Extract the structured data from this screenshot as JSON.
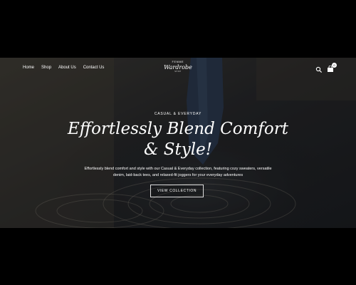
{
  "nav": {
    "links": [
      "Home",
      "Shop",
      "About Us",
      "Contact Us"
    ]
  },
  "brand": {
    "top": "FEMME",
    "name": "Wardrobe",
    "sub": "SHOP"
  },
  "cart": {
    "count": "0"
  },
  "hero": {
    "eyebrow": "CASUAL & EVERYDAY",
    "headline_line1": "Effortlessly Blend Comfort",
    "headline_line2": "& Style!",
    "description_line1": "Effortlessly blend comfort and style with our Casual & Everyday collection, featuring cozy sweaters, versatile",
    "description_line2": "denim, laid-back tees, and relaxed-fit joggers for your everyday adventures",
    "cta_label": "VIEW COLLECTION"
  },
  "colors": {
    "letterbox": "#000000",
    "text": "#ffffff",
    "badge_bg": "#ffffff"
  }
}
